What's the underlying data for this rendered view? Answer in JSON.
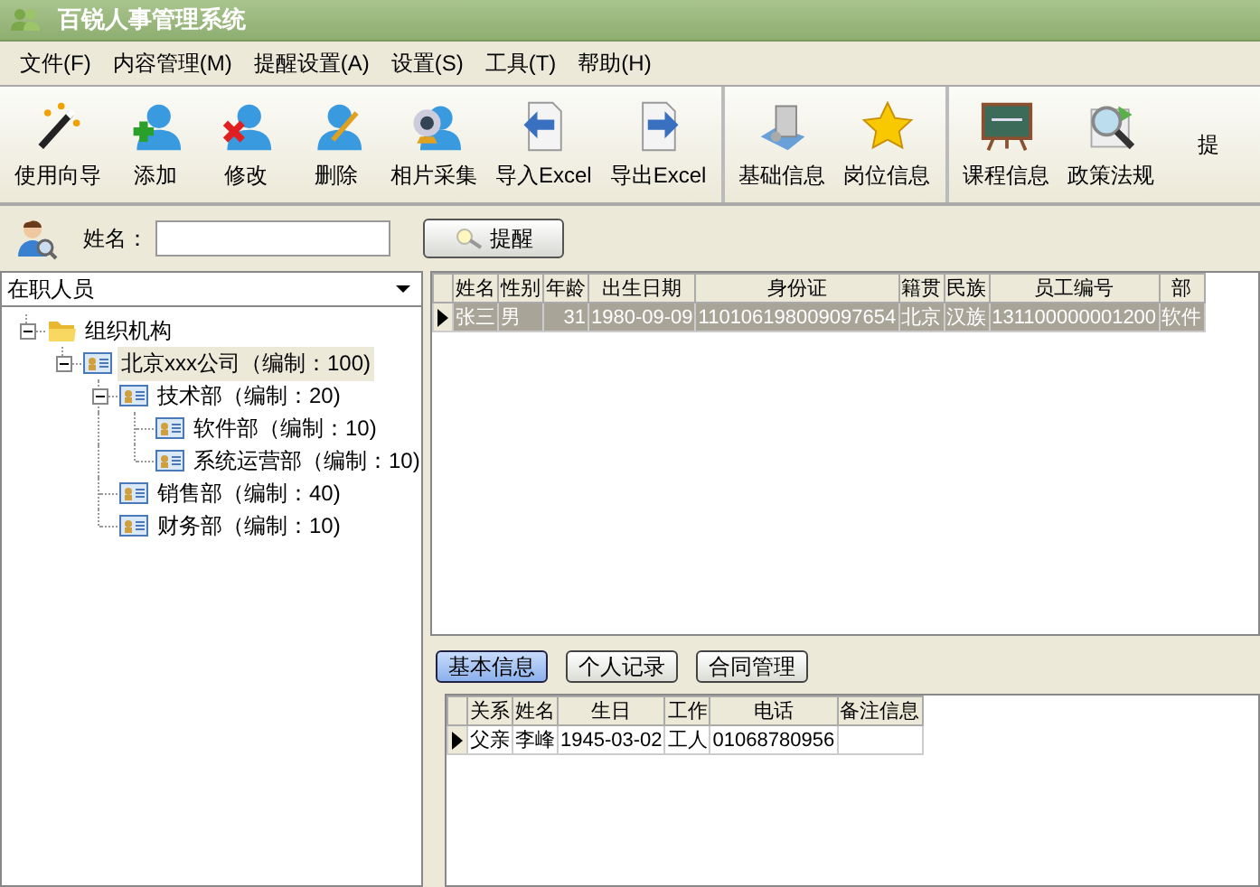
{
  "window": {
    "title": "百锐人事管理系统"
  },
  "menu": [
    "文件(F)",
    "内容管理(M)",
    "提醒设置(A)",
    "设置(S)",
    "工具(T)",
    "帮助(H)"
  ],
  "toolbar": [
    {
      "items": [
        {
          "label": "使用向导",
          "kind": "wand"
        },
        {
          "label": "添加",
          "kind": "user-add"
        },
        {
          "label": "修改",
          "kind": "user-remove"
        },
        {
          "label": "删除",
          "kind": "user-edit"
        },
        {
          "label": "相片采集",
          "kind": "webcam"
        },
        {
          "label": "导入Excel",
          "kind": "import"
        },
        {
          "label": "导出Excel",
          "kind": "export"
        }
      ]
    },
    {
      "items": [
        {
          "label": "基础信息",
          "kind": "scroll"
        },
        {
          "label": "岗位信息",
          "kind": "star"
        }
      ]
    },
    {
      "items": [
        {
          "label": "课程信息",
          "kind": "board"
        },
        {
          "label": "政策法规",
          "kind": "search"
        },
        {
          "label": "提",
          "kind": "none"
        }
      ]
    }
  ],
  "search": {
    "label": "姓名：",
    "button": "提醒"
  },
  "filter": {
    "value": "在职人员"
  },
  "tree": [
    {
      "label": "组织机构",
      "kind": "folder",
      "expanded": true,
      "selected": false,
      "children": [
        {
          "label": "北京xxx公司（编制：100)",
          "kind": "unit",
          "expanded": true,
          "selected": true,
          "children": [
            {
              "label": "技术部（编制：20)",
              "kind": "unit",
              "expanded": true,
              "selected": false,
              "children": [
                {
                  "label": "软件部（编制：10)",
                  "kind": "unit",
                  "selected": false
                },
                {
                  "label": "系统运营部（编制：10)",
                  "kind": "unit",
                  "selected": false
                }
              ]
            },
            {
              "label": "销售部（编制：40)",
              "kind": "unit",
              "selected": false
            },
            {
              "label": "财务部（编制：10)",
              "kind": "unit",
              "selected": false
            }
          ]
        }
      ]
    }
  ],
  "grid": {
    "columns": [
      "姓名",
      "性别",
      "年龄",
      "出生日期",
      "身份证",
      "籍贯",
      "民族",
      "员工编号",
      "部"
    ],
    "rows": [
      {
        "selected": true,
        "cells": [
          "张三",
          "男",
          "31",
          "1980-09-09",
          "110106198009097654",
          "北京",
          "汉族",
          "131100000001200",
          "软件"
        ]
      }
    ]
  },
  "tabs": [
    {
      "label": "基本信息",
      "selected": true
    },
    {
      "label": "个人记录",
      "selected": false
    },
    {
      "label": "合同管理",
      "selected": false
    }
  ],
  "family": {
    "columns": [
      "关系",
      "姓名",
      "生日",
      "工作",
      "电话",
      "备注信息"
    ],
    "rows": [
      {
        "selected": true,
        "cells": [
          "父亲",
          "李峰",
          "1945-03-02",
          "工人",
          "01068780956",
          ""
        ]
      }
    ]
  }
}
